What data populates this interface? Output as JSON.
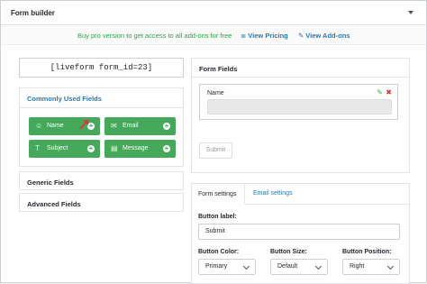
{
  "header": {
    "title": "Form builder"
  },
  "promo": {
    "text": "Buy pro version to get access to all add-ons for free",
    "pricing_icon": "≣",
    "pricing_label": "View Pricing",
    "addons_icon": "✎",
    "addons_label": "View Add-ons"
  },
  "shortcode": "[liveform form_id=23]",
  "common_fields": {
    "title": "Commonly Used Fields",
    "buttons": [
      {
        "label": "Name",
        "icon": "user-icon"
      },
      {
        "label": "Email",
        "icon": "envelope-icon"
      },
      {
        "label": "Subject",
        "icon": "text-icon"
      },
      {
        "label": "Message",
        "icon": "message-icon"
      }
    ]
  },
  "accordions": {
    "generic": "Generic Fields",
    "advanced": "Advanced Fields"
  },
  "form_fields": {
    "title": "Form Fields",
    "field_label": "Name",
    "submit_label": "Submit"
  },
  "settings": {
    "tabs": [
      "Form settings",
      "Email settings"
    ],
    "button_label_title": "Button label:",
    "button_label_value": "Submit",
    "button_color_title": "Button Color:",
    "button_color_value": "Primary",
    "button_size_title": "Button Size:",
    "button_size_value": "Default",
    "button_position_title": "Button Position:",
    "button_position_value": "Right"
  },
  "colors": {
    "green": "#46a85a",
    "link": "#2a7ab5",
    "promo_text": "#28a745"
  }
}
